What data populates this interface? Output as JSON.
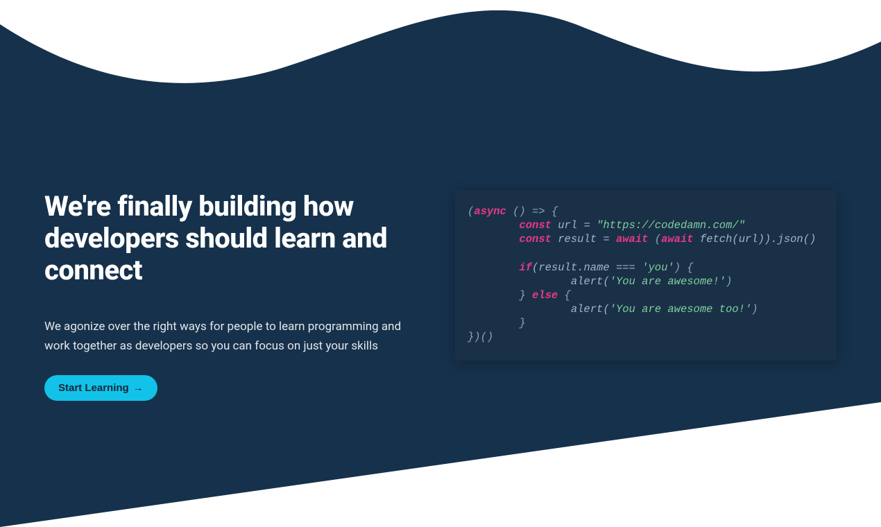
{
  "hero": {
    "heading": "We're finally building how developers should learn and connect",
    "subtext": "We agonize over the right ways for people to learn programming and work together as developers so you can focus on just your skills",
    "cta_label": "Start Learning",
    "cta_arrow": "→"
  },
  "code": {
    "l1_async": "async",
    "l1_rest": " () => {",
    "l1_open": "(",
    "l2_const": "const",
    "l2_url": " url = ",
    "l2_str": "\"https://codedamn.com/\"",
    "l3_const": "const",
    "l3_result": " result = ",
    "l3_await1": "await",
    "l3_mid": " (",
    "l3_await2": "await",
    "l3_fetch": " fetch(url)).json()",
    "l5_if": "if",
    "l5_cond": "(result.name === ",
    "l5_str": "'you'",
    "l5_close": ") {",
    "l6_alert": "alert(",
    "l6_str": "'You are awesome!'",
    "l6_close": ")",
    "l7_close": "} ",
    "l7_else": "else",
    "l7_open": " {",
    "l8_alert": "alert(",
    "l8_str": "'You are awesome too!'",
    "l8_close": ")",
    "l9_close": "}",
    "l10_close": "})()"
  },
  "colors": {
    "bg_dark": "#16314b",
    "code_bg": "#1a3047",
    "accent": "#13c2e8",
    "kw_pink": "#e63986",
    "string_green": "#7fcf9e",
    "punc_gray": "#8fa4b8"
  }
}
